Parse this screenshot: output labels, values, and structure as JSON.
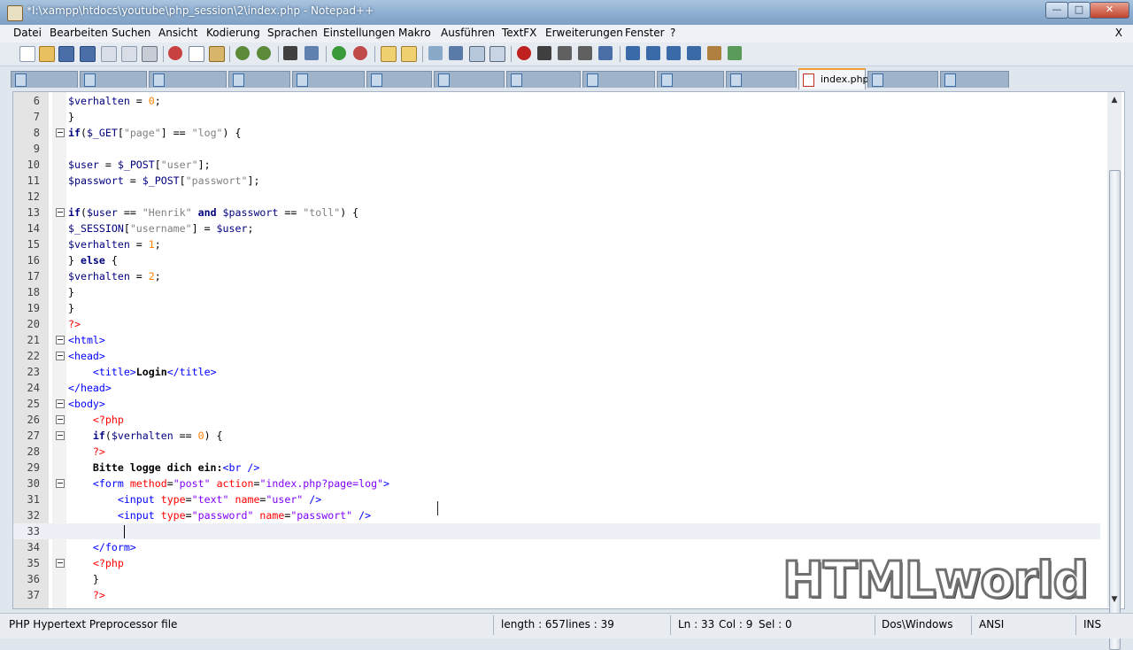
{
  "window": {
    "title": "*I:\\xampp\\htdocs\\youtube\\php_session\\2\\index.php - Notepad++"
  },
  "menu": [
    "Datei",
    "Bearbeiten",
    "Suchen",
    "Ansicht",
    "Kodierung",
    "Sprachen",
    "Einstellungen",
    "Makro",
    "Ausführen",
    "TextFX",
    "Erweiterungen",
    "Fenster",
    "?"
  ],
  "menu_close": "X",
  "active_tab": "index.php",
  "code_lines": [
    {
      "n": "6",
      "html": "<span class='var'>$verhalten</span> = <span class='num'>0</span>;"
    },
    {
      "n": "7",
      "html": "}"
    },
    {
      "n": "8",
      "html": "<span class='kw'>if</span>(<span class='var'>$_GET</span>[<span class='str'>\"page\"</span>] == <span class='str'>\"log\"</span>) {",
      "fold": true
    },
    {
      "n": "9",
      "html": ""
    },
    {
      "n": "10",
      "html": "<span class='var'>$user</span> = <span class='var'>$_POST</span>[<span class='str'>\"user\"</span>];"
    },
    {
      "n": "11",
      "html": "<span class='var'>$passwort</span> = <span class='var'>$_POST</span>[<span class='str'>\"passwort\"</span>];"
    },
    {
      "n": "12",
      "html": ""
    },
    {
      "n": "13",
      "html": "<span class='kw'>if</span>(<span class='var'>$user</span> == <span class='str'>\"Henrik\"</span> <span class='kw'>and</span> <span class='var'>$passwort</span> == <span class='str'>\"toll\"</span>) {",
      "fold": true
    },
    {
      "n": "14",
      "html": "<span class='var'>$_SESSION</span>[<span class='str'>\"username\"</span>] = <span class='var'>$user</span>;"
    },
    {
      "n": "15",
      "html": "<span class='var'>$verhalten</span> = <span class='num'>1</span>;"
    },
    {
      "n": "16",
      "html": "} <span class='kw'>else</span> {"
    },
    {
      "n": "17",
      "html": "<span class='var'>$verhalten</span> = <span class='num'>2</span>;"
    },
    {
      "n": "18",
      "html": "}"
    },
    {
      "n": "19",
      "html": "}"
    },
    {
      "n": "20",
      "html": "<span class='php'>?&gt;</span>"
    },
    {
      "n": "21",
      "html": "<span class='tag'>&lt;html&gt;</span>",
      "fold": true
    },
    {
      "n": "22",
      "html": "<span class='tag'>&lt;head&gt;</span>",
      "fold": true
    },
    {
      "n": "23",
      "html": "    <span class='tag'>&lt;title&gt;</span><span class='bold'>Login</span><span class='tag'>&lt;/title&gt;</span>"
    },
    {
      "n": "24",
      "html": "<span class='tag'>&lt;/head&gt;</span>"
    },
    {
      "n": "25",
      "html": "<span class='tag'>&lt;body&gt;</span>",
      "fold": true
    },
    {
      "n": "26",
      "html": "    <span class='php'>&lt;?php</span>",
      "fold": true
    },
    {
      "n": "27",
      "html": "    <span class='kw'>if</span>(<span class='var'>$verhalten</span> == <span class='num'>0</span>) {",
      "fold": true
    },
    {
      "n": "28",
      "html": "    <span class='php'>?&gt;</span>"
    },
    {
      "n": "29",
      "html": "    <span class='bold'>Bitte logge dich ein:</span><span class='tag'>&lt;br /&gt;</span>"
    },
    {
      "n": "30",
      "html": "    <span class='tag'>&lt;form</span> <span class='attr'>method</span>=<span class='aval'>\"post\"</span> <span class='attr'>action</span>=<span class='aval'>\"index.php?page=log\"</span><span class='tag'>&gt;</span>",
      "fold": true
    },
    {
      "n": "31",
      "html": "        <span class='tag'>&lt;input</span> <span class='attr'>type</span>=<span class='aval'>\"text\"</span> <span class='attr'>name</span>=<span class='aval'>\"user\"</span> <span class='tag'>/&gt;</span>"
    },
    {
      "n": "32",
      "html": "        <span class='tag'>&lt;input</span> <span class='attr'>type</span>=<span class='aval'>\"password\"</span> <span class='attr'>name</span>=<span class='aval'>\"passwort\"</span> <span class='tag'>/&gt;</span>"
    },
    {
      "n": "33",
      "html": "",
      "current": true
    },
    {
      "n": "34",
      "html": "    <span class='tag'>&lt;/form&gt;</span>"
    },
    {
      "n": "35",
      "html": "    <span class='php'>&lt;?php</span>",
      "fold": true
    },
    {
      "n": "36",
      "html": "    }"
    },
    {
      "n": "37",
      "html": "    <span class='php'>?&gt;</span>"
    }
  ],
  "status": {
    "file_type": "PHP Hypertext Preprocessor file",
    "length": "length : 657",
    "lines": "lines : 39",
    "ln": "Ln : 33",
    "col": "Col : 9",
    "sel": "Sel : 0",
    "eol": "Dos\\Windows",
    "encoding": "ANSI",
    "mode": "INS"
  },
  "watermark": "HTMLworld"
}
